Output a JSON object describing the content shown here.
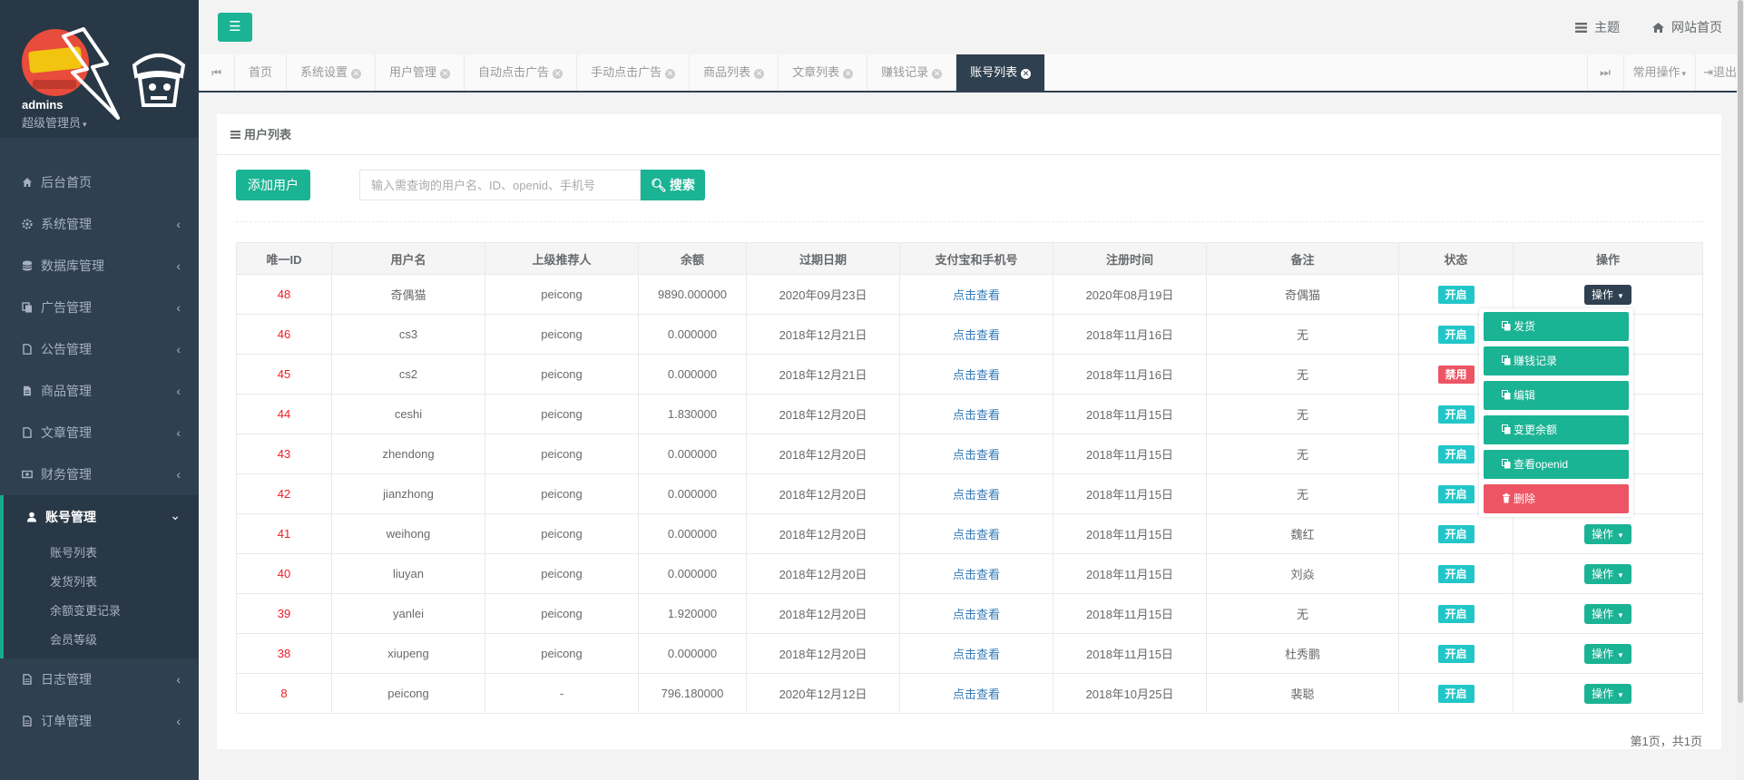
{
  "profile": {
    "name": "admins",
    "role": "超级管理员"
  },
  "sidebar": {
    "items": [
      {
        "label": "后台首页",
        "icon": "home-icon"
      },
      {
        "label": "系统管理",
        "icon": "gear-icon"
      },
      {
        "label": "数据库管理",
        "icon": "database-icon"
      },
      {
        "label": "广告管理",
        "icon": "copy-icon"
      },
      {
        "label": "公告管理",
        "icon": "file-icon"
      },
      {
        "label": "商品管理",
        "icon": "file-icon"
      },
      {
        "label": "文章管理",
        "icon": "file-icon"
      },
      {
        "label": "财务管理",
        "icon": "money-icon"
      },
      {
        "label": "账号管理",
        "icon": "user-icon"
      },
      {
        "label": "日志管理",
        "icon": "file-icon"
      },
      {
        "label": "订单管理",
        "icon": "file-icon"
      }
    ],
    "account_sub": [
      "账号列表",
      "发货列表",
      "余额变更记录",
      "会员等级"
    ]
  },
  "topbar": {
    "theme": "主题",
    "site_home": "网站首页"
  },
  "tabs": {
    "items": [
      "首页",
      "系统设置",
      "用户管理",
      "自动点击广告",
      "手动点击广告",
      "商品列表",
      "文章列表",
      "赚钱记录",
      "账号列表"
    ],
    "ops": "常用操作",
    "logout": "退出"
  },
  "box": {
    "title": "用户列表"
  },
  "toolbar": {
    "add_label": "添加用户",
    "search_placeholder": "输入需查询的用户名、ID、openid、手机号",
    "search_label": "搜索"
  },
  "table": {
    "headers": [
      "唯一ID",
      "用户名",
      "上级推荐人",
      "余额",
      "过期日期",
      "支付宝和手机号",
      "注册时间",
      "备注",
      "状态",
      "操作"
    ],
    "rows": [
      {
        "id": "48",
        "username": "奇偶猫",
        "referrer": "peicong",
        "balance": "9890.000000",
        "expire": "2020年09月23日",
        "alipay": "点击查看",
        "registered": "2020年08月19日",
        "note": "奇偶猫",
        "status": "开启",
        "status_type": "on",
        "op": "操作"
      },
      {
        "id": "46",
        "username": "cs3",
        "referrer": "peicong",
        "balance": "0.000000",
        "expire": "2018年12月21日",
        "alipay": "点击查看",
        "registered": "2018年11月16日",
        "note": "无",
        "status": "开启",
        "status_type": "on",
        "op": ""
      },
      {
        "id": "45",
        "username": "cs2",
        "referrer": "peicong",
        "balance": "0.000000",
        "expire": "2018年12月21日",
        "alipay": "点击查看",
        "registered": "2018年11月16日",
        "note": "无",
        "status": "禁用",
        "status_type": "off",
        "op": ""
      },
      {
        "id": "44",
        "username": "ceshi",
        "referrer": "peicong",
        "balance": "1.830000",
        "expire": "2018年12月20日",
        "alipay": "点击查看",
        "registered": "2018年11月15日",
        "note": "无",
        "status": "开启",
        "status_type": "on",
        "op": ""
      },
      {
        "id": "43",
        "username": "zhendong",
        "referrer": "peicong",
        "balance": "0.000000",
        "expire": "2018年12月20日",
        "alipay": "点击查看",
        "registered": "2018年11月15日",
        "note": "无",
        "status": "开启",
        "status_type": "on",
        "op": ""
      },
      {
        "id": "42",
        "username": "jianzhong",
        "referrer": "peicong",
        "balance": "0.000000",
        "expire": "2018年12月20日",
        "alipay": "点击查看",
        "registered": "2018年11月15日",
        "note": "无",
        "status": "开启",
        "status_type": "on",
        "op": ""
      },
      {
        "id": "41",
        "username": "weihong",
        "referrer": "peicong",
        "balance": "0.000000",
        "expire": "2018年12月20日",
        "alipay": "点击查看",
        "registered": "2018年11月15日",
        "note": "魏红",
        "status": "开启",
        "status_type": "on",
        "op": "操作"
      },
      {
        "id": "40",
        "username": "liuyan",
        "referrer": "peicong",
        "balance": "0.000000",
        "expire": "2018年12月20日",
        "alipay": "点击查看",
        "registered": "2018年11月15日",
        "note": "刘焱",
        "status": "开启",
        "status_type": "on",
        "op": "操作"
      },
      {
        "id": "39",
        "username": "yanlei",
        "referrer": "peicong",
        "balance": "1.920000",
        "expire": "2018年12月20日",
        "alipay": "点击查看",
        "registered": "2018年11月15日",
        "note": "无",
        "status": "开启",
        "status_type": "on",
        "op": "操作"
      },
      {
        "id": "38",
        "username": "xiupeng",
        "referrer": "peicong",
        "balance": "0.000000",
        "expire": "2018年12月20日",
        "alipay": "点击查看",
        "registered": "2018年11月15日",
        "note": "杜秀鹏",
        "status": "开启",
        "status_type": "on",
        "op": "操作"
      },
      {
        "id": "8",
        "username": "peicong",
        "referrer": "-",
        "balance": "796.180000",
        "expire": "2020年12月12日",
        "alipay": "点击查看",
        "registered": "2018年10月25日",
        "note": "裴聪",
        "status": "开启",
        "status_type": "on",
        "op": "操作"
      }
    ]
  },
  "dropdown": {
    "items": [
      {
        "label": "发货",
        "type": "primary"
      },
      {
        "label": "赚钱记录",
        "type": "primary"
      },
      {
        "label": "编辑",
        "type": "primary"
      },
      {
        "label": "变更余额",
        "type": "primary"
      },
      {
        "label": "查看openid",
        "type": "primary"
      },
      {
        "label": "删除",
        "type": "danger"
      }
    ]
  },
  "pager": {
    "text": "第1页，共1页"
  },
  "colors": {
    "primary": "#1ab394",
    "sidebar": "#2f4050",
    "danger": "#ed5565",
    "info": "#23c6c8",
    "id_red": "#ed1c24",
    "link": "#337ab7"
  }
}
